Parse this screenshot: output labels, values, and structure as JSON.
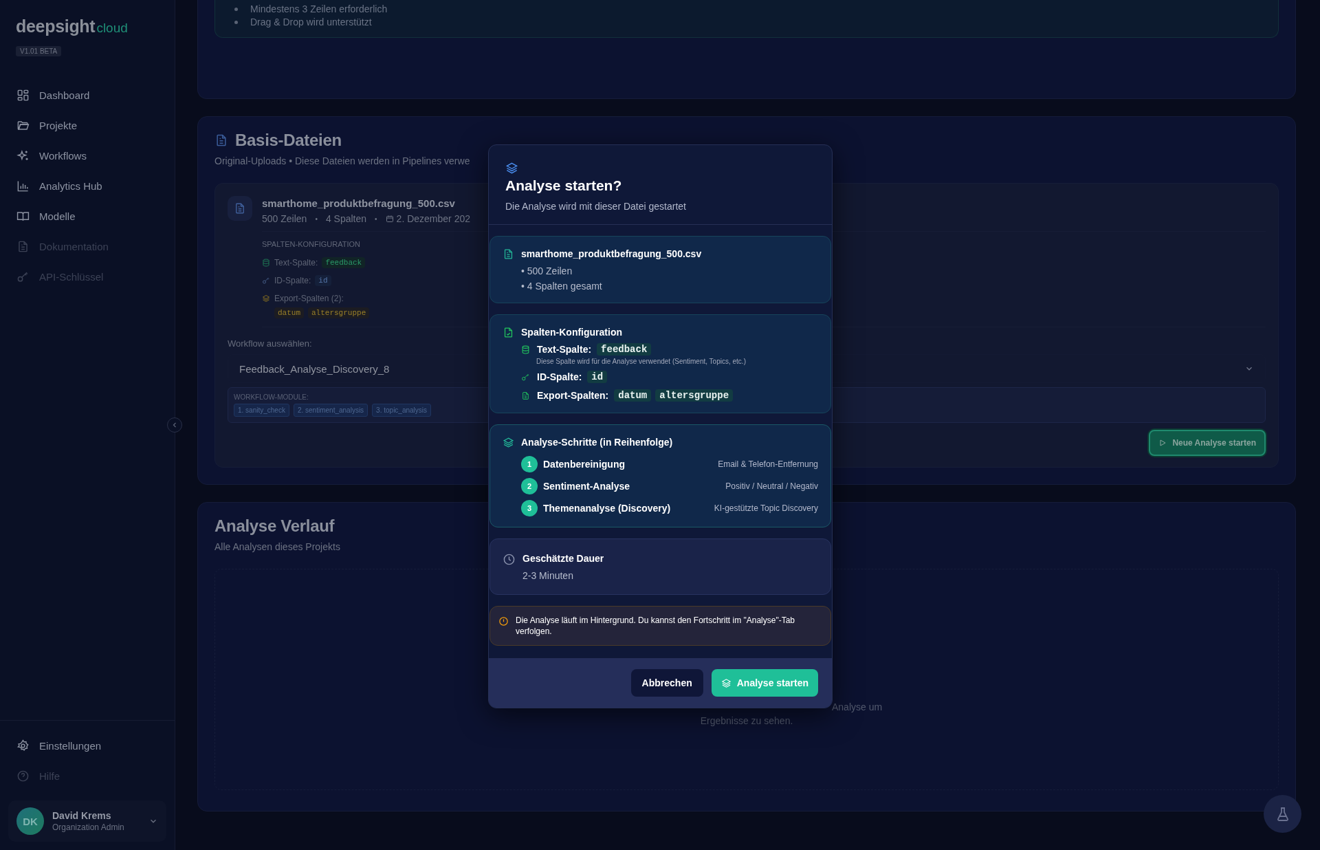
{
  "sidebar": {
    "logo": {
      "name": "deepsight",
      "suffix": "cloud"
    },
    "version": "V1.01 BETA",
    "nav_items": [
      {
        "label": "Dashboard",
        "disabled": false
      },
      {
        "label": "Projekte",
        "disabled": false
      },
      {
        "label": "Workflows",
        "disabled": false
      },
      {
        "label": "Analytics Hub",
        "disabled": false
      },
      {
        "label": "Modelle",
        "disabled": false
      },
      {
        "label": "Dokumentation",
        "disabled": true
      },
      {
        "label": "API-Schlüssel",
        "disabled": true
      }
    ],
    "footer_items": [
      {
        "label": "Einstellungen",
        "disabled": false
      },
      {
        "label": "Hilfe",
        "disabled": true
      }
    ],
    "user": {
      "initials": "DK",
      "name": "David Krems",
      "role": "Organization Admin"
    }
  },
  "upload_hints": [
    "Mindestens 3 Zeilen erforderlich",
    "Drag & Drop wird unterstützt"
  ],
  "base_files": {
    "title": "Basis-Dateien",
    "subtitle": "Original-Uploads • Diese Dateien werden in Pipelines verwe",
    "file": {
      "name": "smarthome_produktbefragung_500.csv",
      "separator": "•",
      "meta": [
        "500 Zeilen",
        "4 Spalten",
        "2. Dezember 202"
      ],
      "config_heading": "SPALTEN-KONFIGURATION",
      "text_label": "Text-Spalte:",
      "text_column": "feedback",
      "id_label": "ID-Spalte:",
      "id_column": "id",
      "export_label": "Export-Spalten (2):",
      "export_columns": [
        "datum",
        "altersgruppe"
      ],
      "workflow_label": "Workflow auswählen:",
      "workflow_value": "Feedback_Analyse_Discovery_8",
      "modules_label": "WORKFLOW-MODULE:",
      "modules": [
        "1. sanity_check",
        "2. sentiment_analysis",
        "3. topic_analysis"
      ],
      "start_button": "Neue Analyse starten"
    }
  },
  "history": {
    "title": "Analyse Verlauf",
    "subtitle": "Alle Analysen dieses Projekts",
    "empty_lines": [
      "Analyse um",
      "Ergebnisse zu sehen."
    ]
  },
  "modal": {
    "title": "Analyse starten?",
    "subtitle": "Die Analyse wird mit dieser Datei gestartet",
    "file": {
      "name": "smarthome_produktbefragung_500.csv",
      "details": [
        "• 500 Zeilen",
        "• 4 Spalten gesamt"
      ]
    },
    "config": {
      "heading": "Spalten-Konfiguration",
      "text_label": "Text-Spalte:",
      "text_column": "feedback",
      "text_note": "Diese Spalte wird für die Analyse verwendet (Sentiment, Topics, etc.)",
      "id_label": "ID-Spalte:",
      "id_column": "id",
      "export_label": "Export-Spalten:",
      "export_columns": [
        "datum",
        "altersgruppe"
      ]
    },
    "steps_heading": "Analyse-Schritte (in Reihenfolge)",
    "steps": [
      {
        "number": "1",
        "name": "Datenbereinigung",
        "description": "Email & Telefon-Entfernung"
      },
      {
        "number": "2",
        "name": "Sentiment-Analyse",
        "description": "Positiv / Neutral / Negativ"
      },
      {
        "number": "3",
        "name": "Themenanalyse (Discovery)",
        "description": "KI-gestützte Topic Discovery"
      }
    ],
    "duration": {
      "label": "Geschätzte Dauer",
      "value": "2-3 Minuten"
    },
    "notice": "Die Analyse läuft im Hintergrund. Du kannst den Fortschritt im \"Analyse\"-Tab verfolgen.",
    "cancel_button": "Abbrechen",
    "confirm_button": "Analyse starten"
  }
}
